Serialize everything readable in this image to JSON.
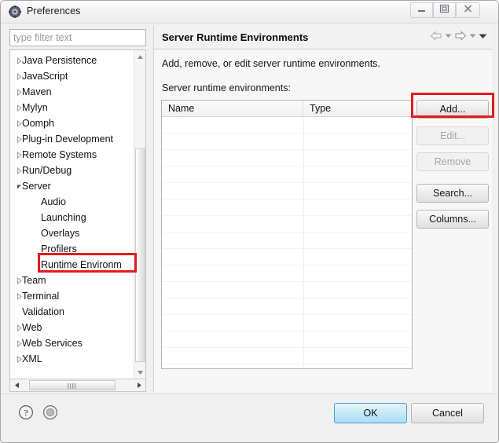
{
  "window": {
    "title": "Preferences",
    "icon": "preferences-gear-icon",
    "buttons": {
      "minimize": "minimize-icon",
      "maximize": "maximize-icon",
      "close": "close-icon"
    }
  },
  "filter": {
    "placeholder": "type filter text",
    "value": ""
  },
  "tree": {
    "items": [
      {
        "label": "Java Persistence",
        "level": 1,
        "expander": "collapsed"
      },
      {
        "label": "JavaScript",
        "level": 1,
        "expander": "collapsed"
      },
      {
        "label": "Maven",
        "level": 1,
        "expander": "collapsed"
      },
      {
        "label": "Mylyn",
        "level": 1,
        "expander": "collapsed"
      },
      {
        "label": "Oomph",
        "level": 1,
        "expander": "collapsed"
      },
      {
        "label": "Plug-in Development",
        "level": 1,
        "expander": "collapsed"
      },
      {
        "label": "Remote Systems",
        "level": 1,
        "expander": "collapsed"
      },
      {
        "label": "Run/Debug",
        "level": 1,
        "expander": "collapsed"
      },
      {
        "label": "Server",
        "level": 1,
        "expander": "expanded"
      },
      {
        "label": "Audio",
        "level": 2,
        "expander": "none"
      },
      {
        "label": "Launching",
        "level": 2,
        "expander": "none"
      },
      {
        "label": "Overlays",
        "level": 2,
        "expander": "none"
      },
      {
        "label": "Profilers",
        "level": 2,
        "expander": "none"
      },
      {
        "label": "Runtime Environm",
        "level": 2,
        "expander": "none",
        "selected": true,
        "truncated": true
      },
      {
        "label": "Team",
        "level": 1,
        "expander": "collapsed"
      },
      {
        "label": "Terminal",
        "level": 1,
        "expander": "collapsed"
      },
      {
        "label": "Validation",
        "level": 1,
        "expander": "none"
      },
      {
        "label": "Web",
        "level": 1,
        "expander": "collapsed"
      },
      {
        "label": "Web Services",
        "level": 1,
        "expander": "collapsed"
      },
      {
        "label": "XML",
        "level": 1,
        "expander": "collapsed"
      }
    ]
  },
  "panel": {
    "title": "Server Runtime Environments",
    "description": "Add, remove, or edit server runtime environments.",
    "list_label": "Server runtime environments:",
    "nav": {
      "back": "back-arrow-icon",
      "back_menu": "chevron-down-icon",
      "forward": "forward-arrow-icon",
      "forward_menu": "chevron-down-icon",
      "view_menu": "chevron-down-icon"
    },
    "table": {
      "columns": [
        "Name",
        "Type"
      ],
      "rows": [],
      "empty_row_count": 15
    },
    "buttons": [
      {
        "label": "Add...",
        "enabled": true,
        "name": "add-button"
      },
      {
        "label": "Edit...",
        "enabled": false,
        "name": "edit-button"
      },
      {
        "label": "Remove",
        "enabled": false,
        "name": "remove-button"
      },
      {
        "label": "Search...",
        "enabled": true,
        "name": "search-button"
      },
      {
        "label": "Columns...",
        "enabled": true,
        "name": "columns-button"
      }
    ]
  },
  "footer": {
    "help_icon": "help-question-icon",
    "info_icon": "info-circle-icon",
    "ok_label": "OK",
    "cancel_label": "Cancel"
  },
  "annotations": {
    "color": "#e31c1c",
    "targets": [
      "tree-item-runtime-environments",
      "add-button"
    ]
  }
}
